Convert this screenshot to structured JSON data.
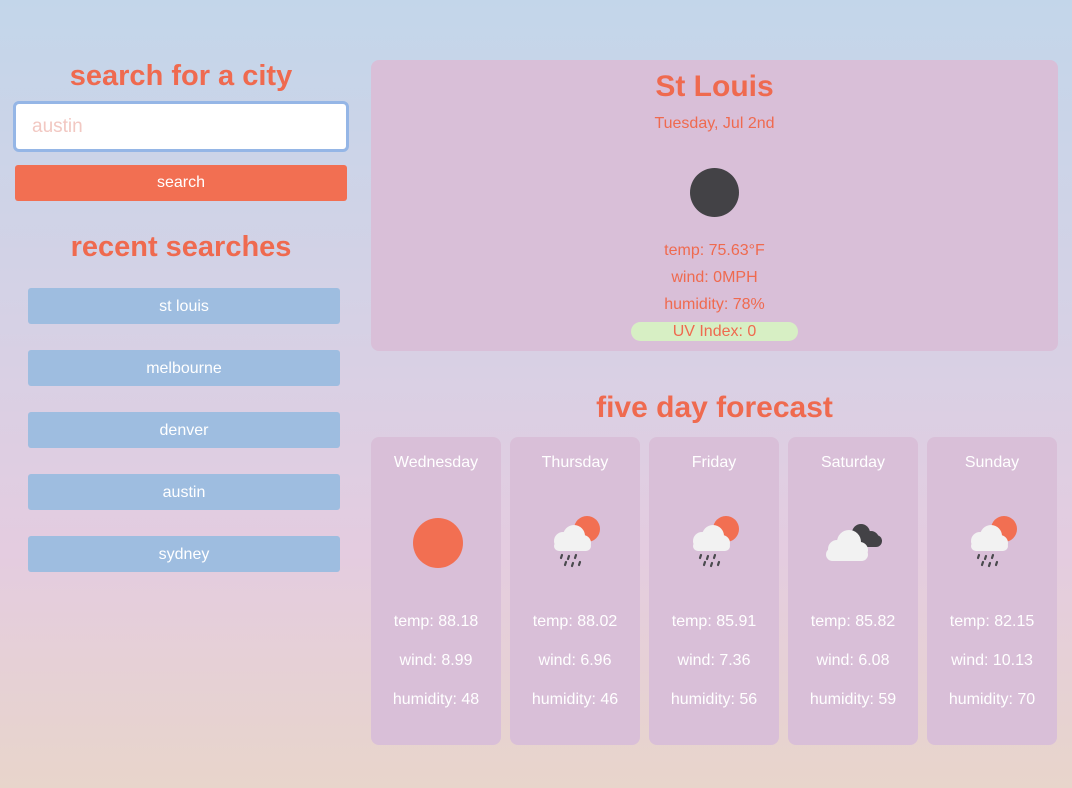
{
  "sidebar": {
    "search_title": "search for a city",
    "search_placeholder": "austin",
    "search_button": "search",
    "recent_title": "recent searches",
    "recent": [
      "st louis",
      "melbourne",
      "denver",
      "austin",
      "sydney"
    ]
  },
  "current": {
    "city": "St Louis",
    "date": "Tuesday, Jul 2nd",
    "icon": "clear-night-icon",
    "temp": "temp: 75.63°F",
    "wind": "wind: 0MPH",
    "humidity": "humidity: 78%",
    "uv": "UV Index: 0"
  },
  "forecast": {
    "title": "five day forecast",
    "days": [
      {
        "name": "Wednesday",
        "icon": "sun-icon",
        "temp": "temp: 88.18",
        "wind": "wind: 8.99",
        "humidity": "humidity: 48"
      },
      {
        "name": "Thursday",
        "icon": "sun-rain-cloud-icon",
        "temp": "temp: 88.02",
        "wind": "wind: 6.96",
        "humidity": "humidity: 46"
      },
      {
        "name": "Friday",
        "icon": "sun-rain-cloud-icon",
        "temp": "temp: 85.91",
        "wind": "wind: 7.36",
        "humidity": "humidity: 56"
      },
      {
        "name": "Saturday",
        "icon": "broken-clouds-icon",
        "temp": "temp: 85.82",
        "wind": "wind: 6.08",
        "humidity": "humidity: 59"
      },
      {
        "name": "Sunday",
        "icon": "sun-rain-cloud-icon",
        "temp": "temp: 82.15",
        "wind": "wind: 10.13",
        "humidity": "humidity: 70"
      }
    ]
  },
  "colors": {
    "accent": "#ef6a4f",
    "button": "#f26f52",
    "recent_button": "#9ebde0",
    "card": "#d9bfd8",
    "uv_badge": "#d7efc4"
  }
}
